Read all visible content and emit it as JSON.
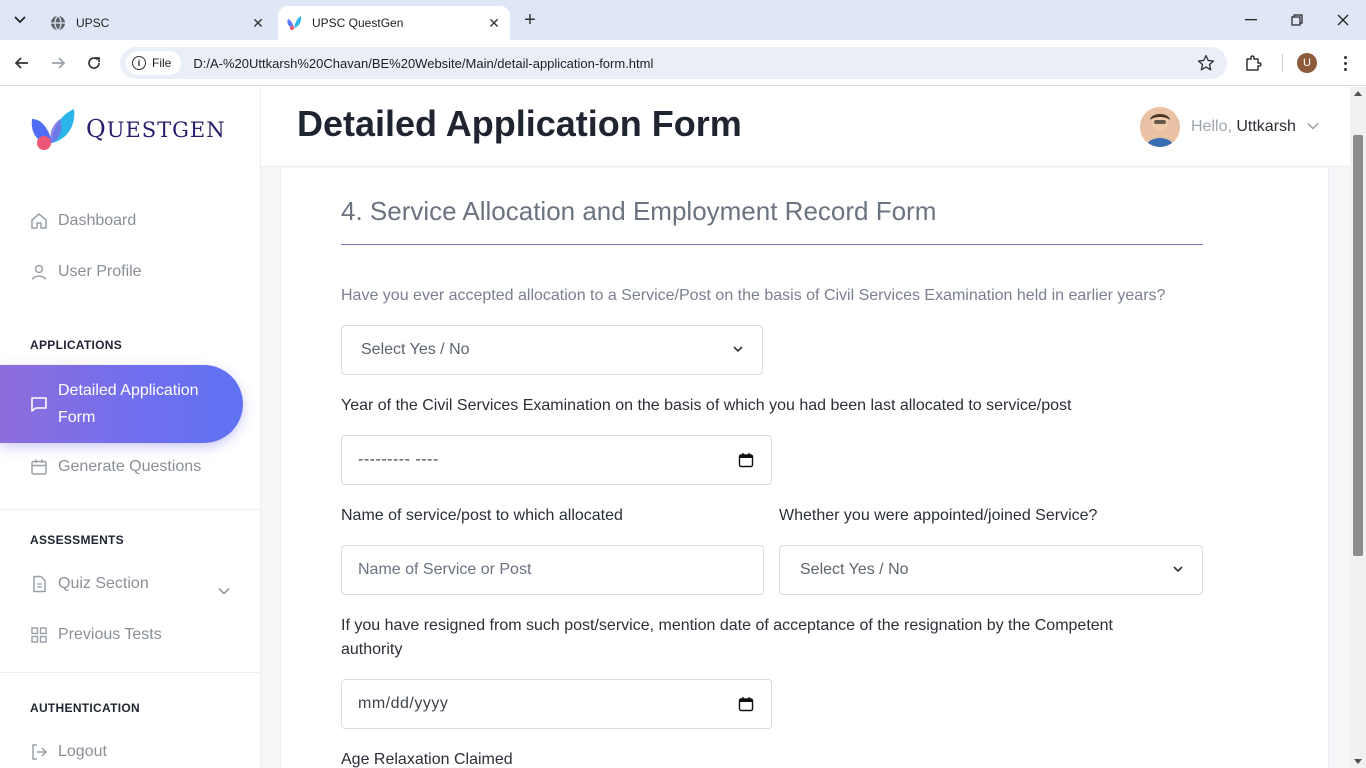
{
  "browser": {
    "tabs": [
      {
        "title": "UPSC",
        "favicon": "globe-icon"
      },
      {
        "title": "UPSC QuestGen",
        "favicon": "questgen-logo"
      }
    ],
    "address_chip": "File",
    "url": "D:/A-%20Uttkarsh%20Chavan/BE%20Website/Main/detail-application-form.html",
    "profile_initial": "U"
  },
  "sidebar": {
    "logo_text_big": "Q",
    "logo_text_rest": "UESTGEN",
    "items_top": [
      {
        "label": "Dashboard",
        "icon": "home-icon"
      },
      {
        "label": "User Profile",
        "icon": "user-icon"
      }
    ],
    "heading_applications": "APPLICATIONS",
    "active_item": {
      "label_line1": "Detailed Application",
      "label_line2": "Form",
      "icon": "message-icon"
    },
    "generate": {
      "label": "Generate Questions",
      "icon": "calendar-icon"
    },
    "heading_assessments": "ASSESSMENTS",
    "quiz": {
      "label": "Quiz Section",
      "icon": "document-icon"
    },
    "previous": {
      "label": "Previous Tests",
      "icon": "grid-icon"
    },
    "heading_authentication": "AUTHENTICATION",
    "logout": {
      "label": "Logout",
      "icon": "logout-icon"
    }
  },
  "header": {
    "title": "Detailed Application Form",
    "greeting": "Hello,",
    "user_name": "Uttkarsh"
  },
  "form": {
    "section_title": "4. Service Allocation and Employment Record Form",
    "q1_label": "Have you ever accepted allocation to a Service/Post on the basis of Civil Services Examination held in earlier years?",
    "q1_value": "Select Yes / No",
    "q2_label": "Year of the Civil Services Examination on the basis of which you had been last allocated to service/post",
    "q2_value": "--------- ----",
    "q3_label": "Name of service/post to which allocated",
    "q3_placeholder": "Name of Service or Post",
    "q4_label": "Whether you were appointed/joined Service?",
    "q4_value": "Select Yes / No",
    "q5_label_line1": "If you have resigned from such post/service, mention date of acceptance of the resignation by the Competent",
    "q5_label_line2": "authority",
    "q5_value": "mm/dd/yyyy",
    "q6_label": "Age Relaxation Claimed"
  },
  "colors": {
    "accent_start": "#8e6ddb",
    "accent_end": "#5f72f2",
    "rule": "#7a72c2",
    "title": "#1f2430"
  }
}
